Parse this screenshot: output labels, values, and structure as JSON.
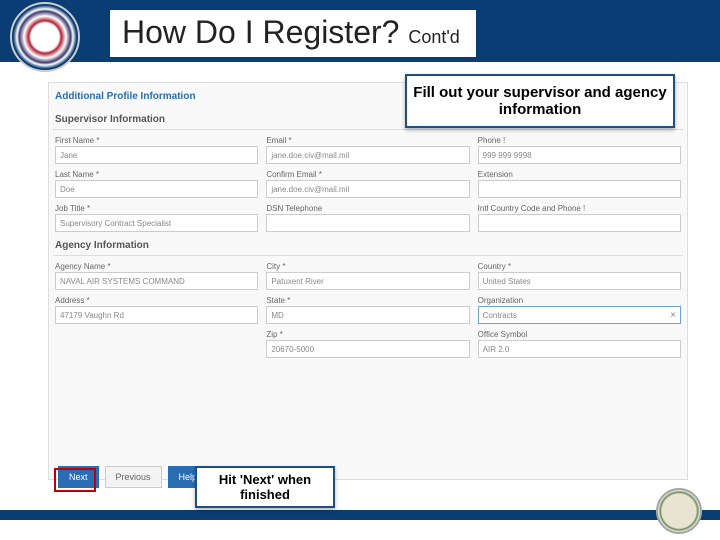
{
  "title": {
    "main": "How Do I Register?",
    "sub": "Cont'd"
  },
  "callouts": {
    "top": "Fill out your supervisor and agency information",
    "bottom": "Hit 'Next' when finished"
  },
  "form": {
    "header": "Additional Profile Information",
    "supervisor": {
      "title": "Supervisor Information",
      "rows": [
        [
          {
            "label": "First Name *",
            "value": "Jane"
          },
          {
            "label": "Email *",
            "value": "jane.doe.civ@mail.mil"
          },
          {
            "label": "Phone !",
            "value": "999 999 9998"
          }
        ],
        [
          {
            "label": "Last Name *",
            "value": "Doe"
          },
          {
            "label": "Confirm Email *",
            "value": "jane.doe.civ@mail.mil"
          },
          {
            "label": "Extension",
            "value": ""
          }
        ],
        [
          {
            "label": "Job Title *",
            "value": "Supervisory Contract Specialist"
          },
          {
            "label": "DSN Telephone",
            "value": ""
          },
          {
            "label": "Intl Country Code and Phone !",
            "value": ""
          }
        ]
      ]
    },
    "agency": {
      "title": "Agency Information",
      "rows": [
        [
          {
            "label": "Agency Name *",
            "value": "NAVAL AIR SYSTEMS COMMAND"
          },
          {
            "label": "City *",
            "value": "Patuxent River"
          },
          {
            "label": "Country *",
            "value": "United States"
          }
        ],
        [
          {
            "label": "Address *",
            "value": "47179 Vaughn Rd"
          },
          {
            "label": "State *",
            "value": "MD"
          },
          {
            "label": "Organization",
            "value": "Contracts",
            "org": true
          }
        ],
        [
          null,
          {
            "label": "Zip *",
            "value": "20670-5000"
          },
          {
            "label": "Office Symbol",
            "value": "AIR 2.0"
          }
        ]
      ]
    }
  },
  "buttons": {
    "next": "Next",
    "previous": "Previous",
    "help": "Help"
  }
}
